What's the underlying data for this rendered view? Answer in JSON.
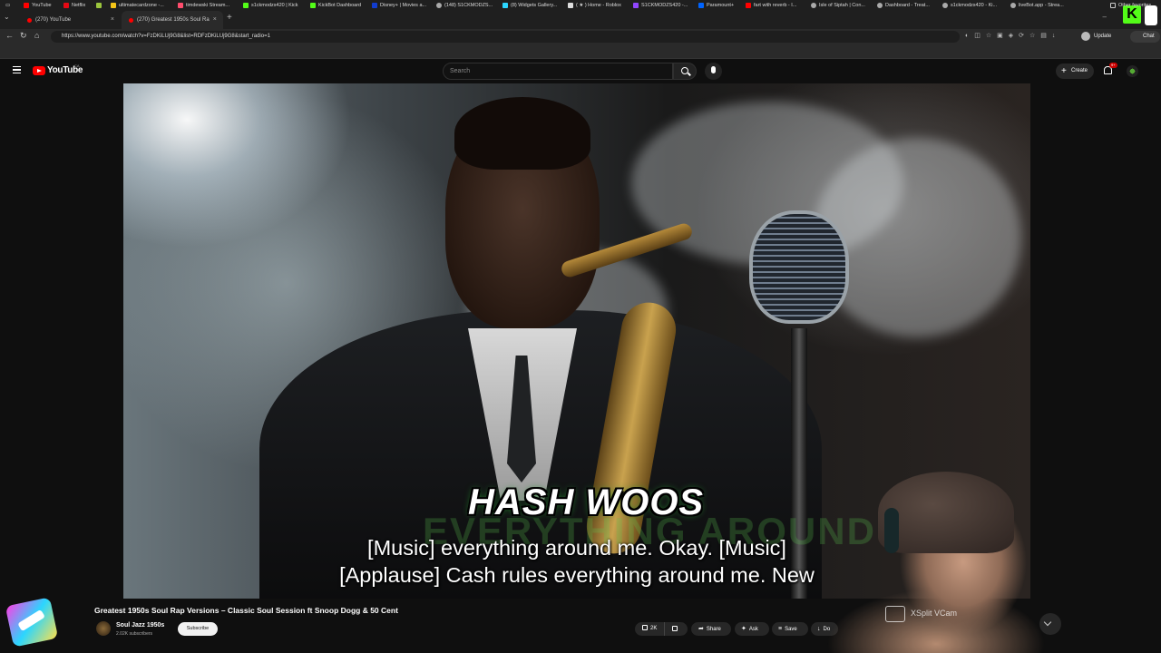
{
  "browser": {
    "tabs": [
      {
        "label": "(270) YouTube"
      },
      {
        "label": "(270) Greatest 1950s Soul Ra"
      }
    ],
    "url": "https://www.youtube.com/watch?v=FzDKiLUj9G8&list=RDFzDKiLUj9G8&start_radio=1",
    "update_label": "Update",
    "chat_label": "Chat",
    "bookmarks": [
      {
        "label": "YouTube",
        "color": "#ff0000"
      },
      {
        "label": "Netflix",
        "color": "#e50914"
      },
      {
        "label": "",
        "color": "#9bc53d"
      },
      {
        "label": "ultimatecardzone -...",
        "color": "#f5c518"
      },
      {
        "label": "timdewski Stream...",
        "color": "#ff4d6d"
      },
      {
        "label": "s1ckmodzs420 | Kick",
        "color": "#53fc18"
      },
      {
        "label": "KickBot Dashboard",
        "color": "#53fc18"
      },
      {
        "label": "Disney+ | Movies a...",
        "color": "#113ccf"
      },
      {
        "label": "(148) S1CKMODZS...",
        "color": "#aaaaaa"
      },
      {
        "label": "(8) Widgets Gallery...",
        "color": "#2bd6ff"
      },
      {
        "label": "( ★ ) Home - Roblox",
        "color": "#dddddd"
      },
      {
        "label": "S1CKMODZS420 -...",
        "color": "#9146ff"
      },
      {
        "label": "Paramount+",
        "color": "#0064ff"
      },
      {
        "label": "fart with reverb - I...",
        "color": "#ff0000"
      },
      {
        "label": "Isle of Siptah | Con...",
        "color": "#aaaaaa"
      },
      {
        "label": "Dashboard - Treat...",
        "color": "#aaaaaa"
      },
      {
        "label": "s1ckmodzs420 - Ki...",
        "color": "#aaaaaa"
      },
      {
        "label": "liveBot.app - Strea...",
        "color": "#aaaaaa"
      }
    ],
    "other_favorites": "Other favorites"
  },
  "youtube": {
    "brand": "YouTube",
    "country": "CA",
    "search_placeholder": "Search",
    "create_label": "Create",
    "notifications": "9+"
  },
  "video": {
    "overlay_title": "HASH WOOS",
    "background_text": "EVERYTHING AROUND ME",
    "caption_line1": "[Music] everything around me. Okay. [Music]",
    "caption_line2": "[Applause] Cash rules everything around me. New",
    "title": "Greatest 1950s Soul Rap Versions – Classic Soul Session ft Snoop Dogg & 50 Cent",
    "channel": "Soul Jazz 1950s",
    "subscribers": "2.02K subscribers",
    "subscribe_label": "Subscribe",
    "likes": "2K",
    "share_label": "Share",
    "ask_label": "Ask",
    "save_label": "Save",
    "download_label": "Do"
  },
  "webcam": {
    "badge": "XSplit VCam"
  }
}
